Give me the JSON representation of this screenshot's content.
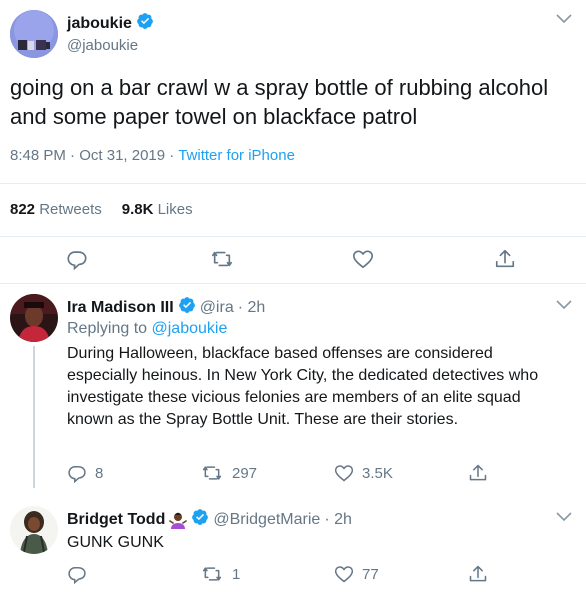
{
  "main_tweet": {
    "display_name": "jaboukie",
    "handle": "@jaboukie",
    "text": "going on a bar crawl w a spray bottle of rubbing alcohol and some paper towel on blackface patrol",
    "time": "8:48 PM",
    "date": "Oct 31, 2019",
    "source": "Twitter for iPhone",
    "meta_separator": "·",
    "retweets_count": "822",
    "retweets_label": "Retweets",
    "likes_count": "9.8K",
    "likes_label": "Likes"
  },
  "replies": [
    {
      "display_name": "Ira Madison III",
      "handle": "@ira",
      "time": "· 2h",
      "replying_label": "Replying to",
      "replying_to": "@jaboukie",
      "text": "During Halloween, blackface based offenses are considered especially heinous. In New York City, the dedicated detectives who investigate these vicious felonies are members of an elite squad known as the Spray Bottle Unit. These are their stories.",
      "reply_count": "8",
      "retweet_count": "297",
      "like_count": "3.5K"
    },
    {
      "display_name": "Bridget Todd",
      "handle": "@BridgetMarie",
      "time": "· 2h",
      "text": "GUNK GUNK",
      "reply_count": "",
      "retweet_count": "1",
      "like_count": "77"
    }
  ],
  "colors": {
    "link": "#1da1f2",
    "secondary_text": "#657786",
    "primary_text": "#14171a",
    "divider": "#e6ecf0",
    "verified": "#1da1f2"
  },
  "icons": {
    "verified": "verified-badge-icon",
    "chevron": "chevron-down-icon",
    "reply": "reply-icon",
    "retweet": "retweet-icon",
    "like": "heart-icon",
    "share": "share-icon",
    "emoji": "person-shrugging-emoji"
  }
}
